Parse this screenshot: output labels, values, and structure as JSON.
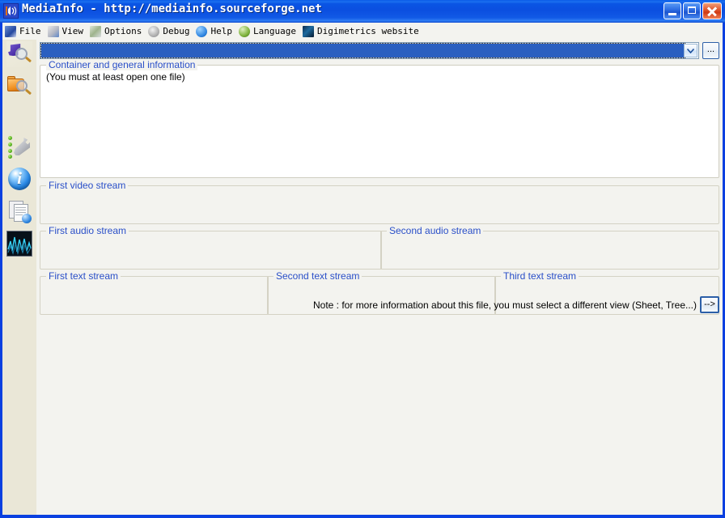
{
  "window": {
    "title": "MediaInfo - http://mediainfo.sourceforge.net",
    "icon": "speaker-wave-icon",
    "buttons": {
      "minimize": "minimize-icon",
      "maximize": "maximize-icon",
      "close": "close-icon"
    },
    "accent_titlebar": "#0b4fe0",
    "accent_close": "#d03a14",
    "frame_color": "#0a40e0",
    "client_background": "#f3f3ef",
    "sidebar_background": "#eae7d7"
  },
  "menubar": {
    "items": [
      {
        "label": "File",
        "icon": "file-open-icon"
      },
      {
        "label": "View",
        "icon": "view-icon"
      },
      {
        "label": "Options",
        "icon": "options-wrench-icon"
      },
      {
        "label": "Debug",
        "icon": "debug-icon"
      },
      {
        "label": "Help",
        "icon": "help-info-icon"
      },
      {
        "label": "Language",
        "icon": "language-globe-icon"
      },
      {
        "label": "Digimetrics website",
        "icon": "digimetrics-icon"
      }
    ]
  },
  "sidebar": {
    "items": [
      {
        "name": "open-file",
        "icon": "open-file-magnifier-icon"
      },
      {
        "name": "open-folder",
        "icon": "open-folder-magnifier-icon"
      },
      {
        "name": "options",
        "icon": "wrench-options-icon"
      },
      {
        "name": "about",
        "icon": "info-circle-icon"
      },
      {
        "name": "export-sheet",
        "icon": "sheet-export-icon"
      },
      {
        "name": "graph-view",
        "icon": "waveform-icon"
      }
    ]
  },
  "toolbar": {
    "file_combo": {
      "value": "",
      "placeholder": "",
      "dropdown_icon": "chevron-down-icon"
    },
    "browse_label": "...",
    "selection_color": "#2a5fc0"
  },
  "panels": {
    "container": {
      "legend": "Container and general information",
      "body": "(You must at least open one file)"
    },
    "video1": {
      "legend": "First video stream",
      "body": ""
    },
    "audio1": {
      "legend": "First audio stream",
      "body": ""
    },
    "audio2": {
      "legend": "Second audio stream",
      "body": ""
    },
    "text1": {
      "legend": "First text stream",
      "body": ""
    },
    "text2": {
      "legend": "Second text stream",
      "body": ""
    },
    "text3": {
      "legend": "Third text stream",
      "body": ""
    },
    "legend_color": "#2a4fc8"
  },
  "footer": {
    "note": "Note : for more information about this file, you must select a different view (Sheet, Tree...)",
    "arrow_label": "-->"
  }
}
